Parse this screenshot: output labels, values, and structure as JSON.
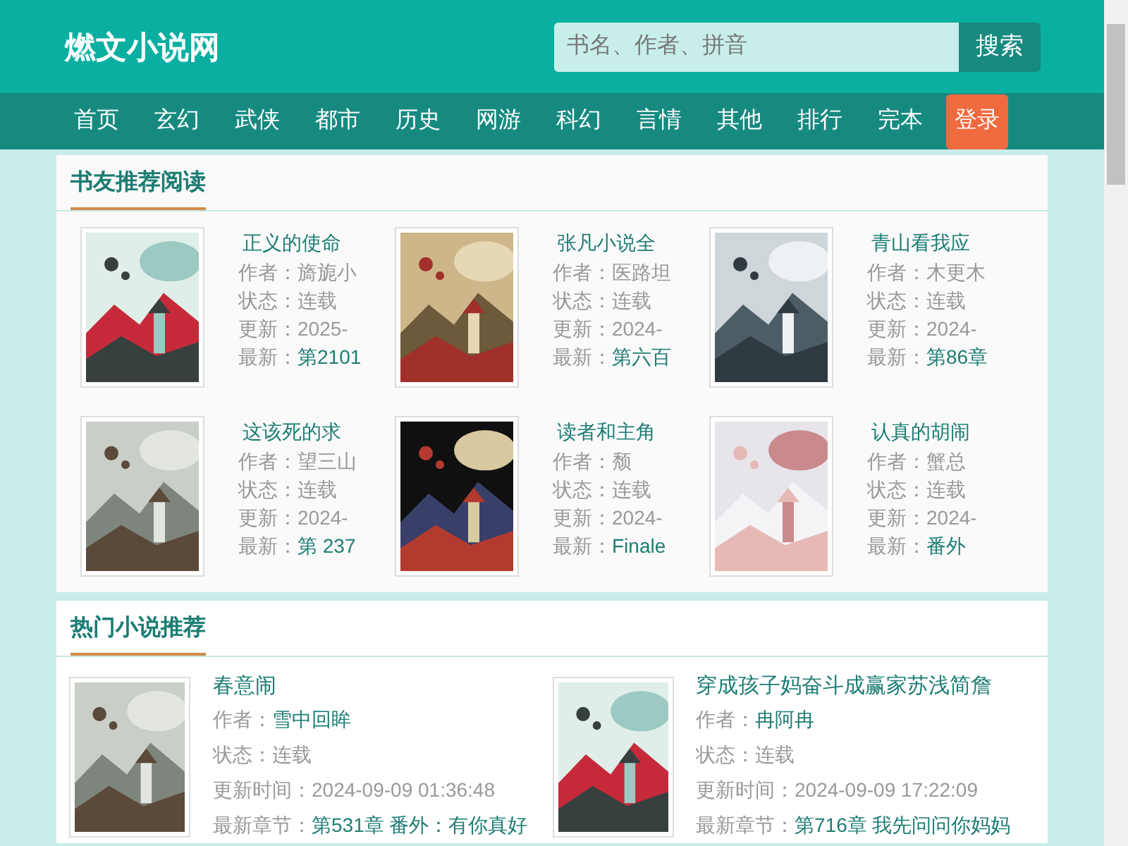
{
  "header": {
    "logo": "燃文小说网",
    "search": {
      "placeholder": "书名、作者、拼音",
      "button": "搜索"
    }
  },
  "nav": {
    "items": [
      {
        "label": "首页"
      },
      {
        "label": "玄幻"
      },
      {
        "label": "武侠"
      },
      {
        "label": "都市"
      },
      {
        "label": "历史"
      },
      {
        "label": "网游"
      },
      {
        "label": "科幻"
      },
      {
        "label": "言情"
      },
      {
        "label": "其他"
      },
      {
        "label": "排行"
      },
      {
        "label": "完本"
      }
    ],
    "login": "登录"
  },
  "recommend": {
    "title": "书友推荐阅读",
    "books": [
      {
        "title": "正义的使命",
        "lines": [
          {
            "label": "作者：",
            "value": "旖旎小",
            "kind": "plain"
          },
          {
            "label": "状态：",
            "value": "连载",
            "kind": "plain"
          },
          {
            "label": "更新：",
            "value": "2025-",
            "kind": "plain"
          },
          {
            "label": "最新：",
            "value": "第2101",
            "kind": "link"
          }
        ]
      },
      {
        "title": "张凡小说全",
        "lines": [
          {
            "label": "作者：",
            "value": "医路坦",
            "kind": "plain"
          },
          {
            "label": "状态：",
            "value": "连载",
            "kind": "plain"
          },
          {
            "label": "更新：",
            "value": "2024-",
            "kind": "plain"
          },
          {
            "label": "最新：",
            "value": "第六百",
            "kind": "link"
          }
        ]
      },
      {
        "title": "青山看我应",
        "lines": [
          {
            "label": "作者：",
            "value": "木更木",
            "kind": "plain"
          },
          {
            "label": "状态：",
            "value": "连载",
            "kind": "plain"
          },
          {
            "label": "更新：",
            "value": "2024-",
            "kind": "plain"
          },
          {
            "label": "最新：",
            "value": "第86章",
            "kind": "link"
          }
        ]
      },
      {
        "title": "这该死的求",
        "lines": [
          {
            "label": "作者：",
            "value": "望三山",
            "kind": "plain"
          },
          {
            "label": "状态：",
            "value": "连载",
            "kind": "plain"
          },
          {
            "label": "更新：",
            "value": "2024-",
            "kind": "plain"
          },
          {
            "label": "最新：",
            "value": "第 237",
            "kind": "link"
          }
        ]
      },
      {
        "title": "读者和主角",
        "lines": [
          {
            "label": "作者：",
            "value": "颓",
            "kind": "plain"
          },
          {
            "label": "状态：",
            "value": "连载",
            "kind": "plain"
          },
          {
            "label": "更新：",
            "value": "2024-",
            "kind": "plain"
          },
          {
            "label": "最新：",
            "value": "Finale",
            "kind": "link"
          }
        ]
      },
      {
        "title": "认真的胡闹",
        "lines": [
          {
            "label": "作者：",
            "value": "蟹总",
            "kind": "plain"
          },
          {
            "label": "状态：",
            "value": "连载",
            "kind": "plain"
          },
          {
            "label": "更新：",
            "value": "2024-",
            "kind": "plain"
          },
          {
            "label": "最新：",
            "value": "番外",
            "kind": "link"
          }
        ]
      }
    ]
  },
  "hot": {
    "title": "热门小说推荐",
    "books": [
      {
        "title": "春意闹",
        "lines": [
          {
            "label": "作者：",
            "value": "雪中回眸",
            "kind": "link"
          },
          {
            "label": "状态：",
            "value": "连载",
            "kind": "plain"
          },
          {
            "label": "更新时间：",
            "value": "2024-09-09 01:36:48",
            "kind": "plain"
          },
          {
            "label": "最新章节：",
            "value": "第531章 番外：有你真好",
            "kind": "link"
          }
        ]
      },
      {
        "title": "穿成孩子妈奋斗成赢家苏浅简詹",
        "lines": [
          {
            "label": "作者：",
            "value": "冉阿冉",
            "kind": "link"
          },
          {
            "label": "状态：",
            "value": "连载",
            "kind": "plain"
          },
          {
            "label": "更新时间：",
            "value": "2024-09-09 17:22:09",
            "kind": "plain"
          },
          {
            "label": "最新章节：",
            "value": "第716章 我先问问你妈妈",
            "kind": "link"
          }
        ]
      }
    ]
  }
}
